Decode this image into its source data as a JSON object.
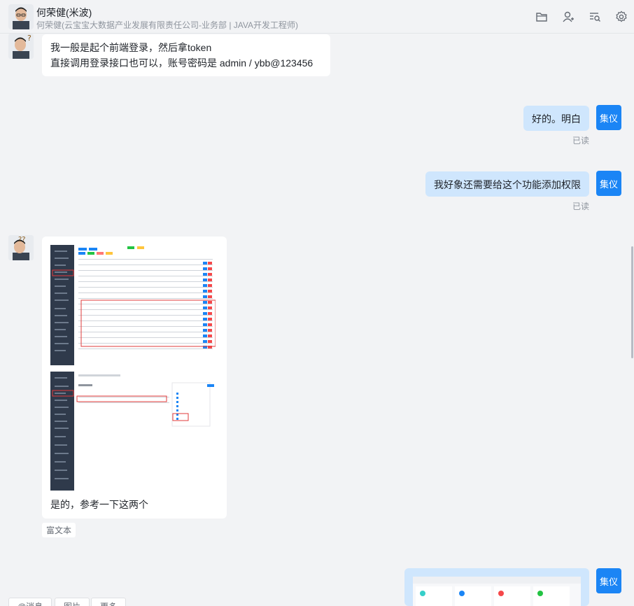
{
  "header": {
    "name": "何荣健(米波)",
    "subtitle": "何荣健(云宝宝大数据产业发展有限责任公司-业务部 | JAVA开发工程师)"
  },
  "messages": {
    "m1": {
      "line1": "我一般是起个前端登录，然后拿token",
      "line2": "直接调用登录接口也可以，账号密码是 admin / ybb@123456"
    },
    "m2": {
      "text": "好的。明白",
      "status": "已读"
    },
    "m3": {
      "text": "我好象还需要给这个功能添加权限",
      "status": "已读"
    },
    "m4": {
      "caption": "是的，参考一下这两个",
      "tag": "富文本"
    }
  },
  "self_badge": "集仪",
  "footer": {
    "btn1": "@消息",
    "btn2": "图片",
    "btn3": "更多"
  }
}
